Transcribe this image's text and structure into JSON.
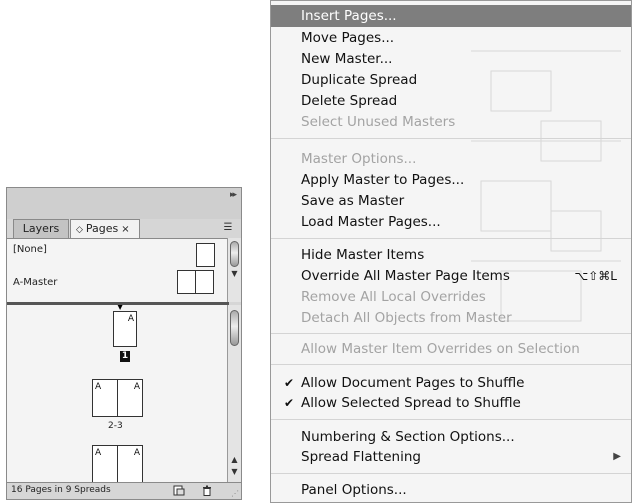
{
  "panel": {
    "tabs": {
      "layers": "Layers",
      "pages": "Pages",
      "pages_prefix": "◇",
      "close": "×"
    },
    "masters": {
      "none_label": "[None]",
      "a_master_label": "A-Master"
    },
    "pages": [
      {
        "letter_left": "",
        "letter_right": "A",
        "number": "1"
      },
      {
        "letter_left": "A",
        "letter_right": "A",
        "number": "2-3"
      },
      {
        "letter_left": "A",
        "letter_right": "A",
        "number": ""
      }
    ],
    "status": "16 Pages in 9 Spreads"
  },
  "menu": {
    "items": [
      {
        "label": "Insert Pages...",
        "state": "highlight"
      },
      {
        "label": "Move Pages...",
        "state": "enabled"
      },
      {
        "label": "New Master...",
        "state": "enabled"
      },
      {
        "label": "Duplicate Spread",
        "state": "enabled"
      },
      {
        "label": "Delete Spread",
        "state": "enabled"
      },
      {
        "label": "Select Unused Masters",
        "state": "disabled"
      },
      {
        "label": "Master Options...",
        "state": "disabled"
      },
      {
        "label": "Apply Master to Pages...",
        "state": "enabled"
      },
      {
        "label": "Save as Master",
        "state": "enabled"
      },
      {
        "label": "Load Master Pages...",
        "state": "enabled"
      },
      {
        "label": "Hide Master Items",
        "state": "enabled"
      },
      {
        "label": "Override All Master Page Items",
        "state": "enabled",
        "shortcut": "⌥⇧⌘L"
      },
      {
        "label": "Remove All Local Overrides",
        "state": "disabled"
      },
      {
        "label": "Detach All Objects from Master",
        "state": "disabled"
      },
      {
        "label": "Allow Master Item Overrides on Selection",
        "state": "disabled"
      },
      {
        "label": "Allow Document Pages to Shuffle",
        "state": "enabled",
        "checked": true
      },
      {
        "label": "Allow Selected Spread to Shuffle",
        "state": "enabled",
        "checked": true
      },
      {
        "label": "Numbering & Section Options...",
        "state": "enabled"
      },
      {
        "label": "Spread Flattening",
        "state": "enabled",
        "submenu": true
      },
      {
        "label": "Panel Options...",
        "state": "enabled"
      }
    ],
    "check_glyph": "✔",
    "submenu_glyph": "▶"
  },
  "icons": {
    "collapse": "double-right-arrow-icon",
    "panel_menu": "panel-menu-icon",
    "new_page": "new-page-icon",
    "trash": "trash-icon"
  }
}
